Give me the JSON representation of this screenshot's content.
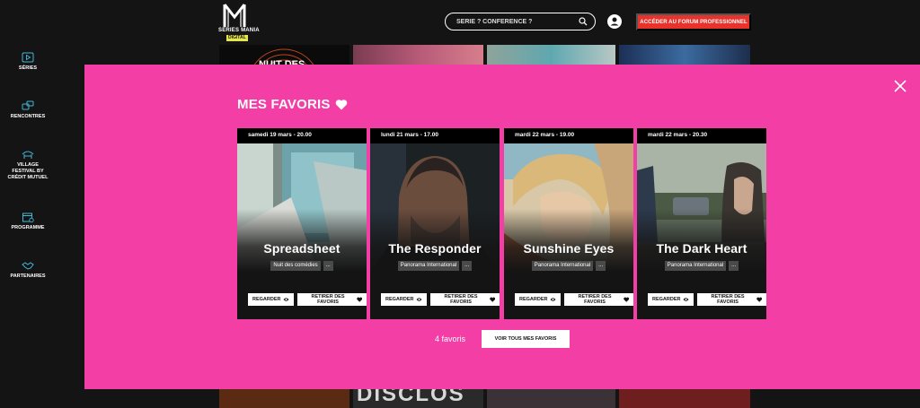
{
  "brand": {
    "name": "SERIES MANIA",
    "tag": "DIGITAL"
  },
  "search": {
    "placeholder": "SÉRIE ? CONFÉRENCE ?"
  },
  "header": {
    "pro_button": "ACCÉDER AU FORUM PROFESSIONNEL"
  },
  "sidebar": {
    "items": [
      {
        "label": "SÉRIES",
        "icon": "play-icon"
      },
      {
        "label": "RENCONTRES",
        "icon": "chat-icon"
      },
      {
        "label": "VILLAGE FESTIVAL BY CRÉDIT MUTUEL",
        "icon": "village-icon"
      },
      {
        "label": "PROGRAMME",
        "icon": "calendar-icon"
      },
      {
        "label": "PARTENAIRES",
        "icon": "handshake-icon"
      }
    ]
  },
  "background": {
    "tile_text": "NUIT DES",
    "bottom_text": "DISCLOS"
  },
  "favorites": {
    "title": "MES FAVORIS",
    "count": "4 favoris",
    "see_all": "VOIR TOUS MES FAVORIS",
    "cards": [
      {
        "date": "samedi 19 mars - 20.00",
        "title": "Spreadsheet",
        "tag": "Nuit des comédies",
        "more": "...",
        "watch": "REGARDER",
        "remove": "RETIRER DES FAVORIS"
      },
      {
        "date": "lundi 21 mars - 17.00",
        "title": "The Responder",
        "tag": "Panorama International",
        "more": "...",
        "watch": "REGARDER",
        "remove": "RETIRER DES FAVORIS"
      },
      {
        "date": "mardi 22 mars - 19.00",
        "title": "Sunshine Eyes",
        "tag": "Panorama International",
        "more": "...",
        "watch": "REGARDER",
        "remove": "RETIRER DES FAVORIS"
      },
      {
        "date": "mardi 22 mars - 20.30",
        "title": "The Dark Heart",
        "tag": "Panorama International",
        "more": "...",
        "watch": "REGARDER",
        "remove": "RETIRER DES FAVORIS"
      }
    ]
  },
  "colors": {
    "overlay": "#f23ea5",
    "accent": "#e8322c",
    "background": "#141414",
    "logo_tag": "#e6e64a"
  }
}
